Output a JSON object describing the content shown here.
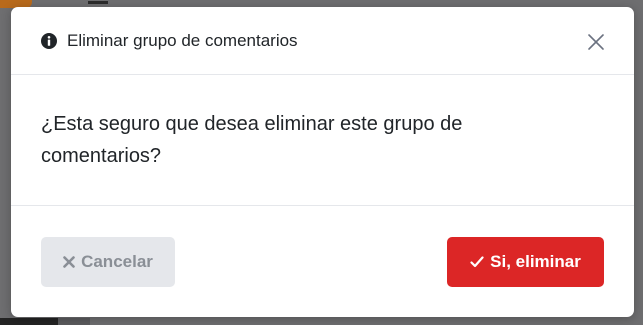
{
  "dialog": {
    "title": "Eliminar grupo de comentarios",
    "message": "¿Esta seguro que desea eliminar este grupo de comentarios?",
    "icons": {
      "header": "info-circle-icon",
      "close": "close-icon",
      "cancel": "times-icon",
      "confirm": "check-icon"
    }
  },
  "buttons": {
    "cancel_label": "Cancelar",
    "confirm_label": "Si, eliminar"
  },
  "colors": {
    "confirm": "#dc2626",
    "cancel_bg": "#e5e7eb",
    "cancel_text": "#8a8f96",
    "backdrop": "#6e6e70"
  }
}
